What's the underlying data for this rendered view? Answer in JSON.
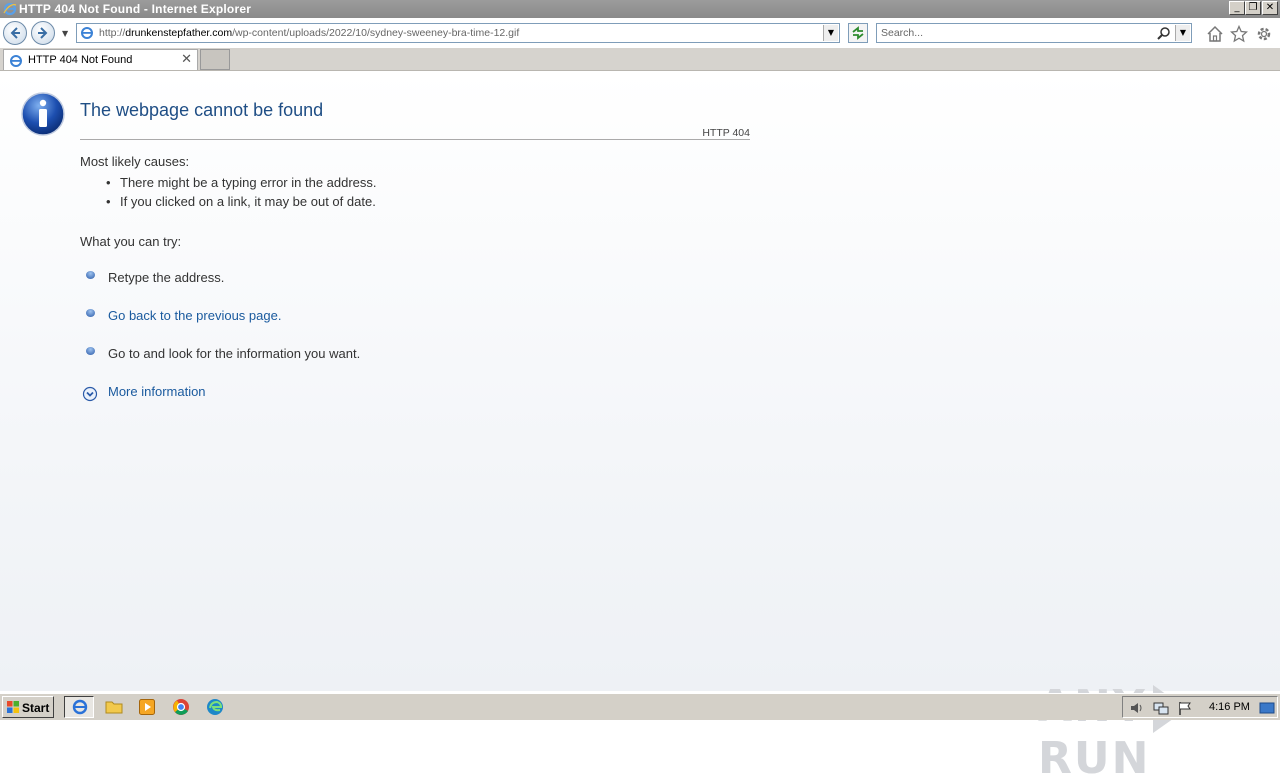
{
  "window": {
    "title": "HTTP 404 Not Found - Internet Explorer",
    "minimize": "_",
    "restore": "❐",
    "close": "✕"
  },
  "navbar": {
    "url_prefix": "http://",
    "url_domain": "drunkenstepfather.com",
    "url_path": "/wp-content/uploads/2022/10/sydney-sweeney-bra-time-12.gif",
    "search_placeholder": "Search...",
    "icons": [
      "back-icon",
      "forward-icon",
      "refresh-icon",
      "search-icon",
      "home-icon",
      "favorites-star-icon",
      "gear-icon"
    ]
  },
  "tabs": [
    {
      "label": "HTTP 404 Not Found",
      "close": "✕"
    }
  ],
  "page": {
    "title": "The webpage cannot be found",
    "code": "HTTP 404",
    "causes_label": "Most likely causes:",
    "causes": [
      "There might be a typing error in the address.",
      "If you clicked on a link, it may be out of date."
    ],
    "try_label": "What you can try:",
    "try_items": [
      {
        "text": "Retype the address.",
        "link": false
      },
      {
        "text": "Go back to the previous page.",
        "link": true
      },
      {
        "text": "Go to  and look for the information you want.",
        "link": false
      }
    ],
    "more_info": "More information",
    "bullet": "•"
  },
  "watermark": {
    "left": "ANY",
    "right": "RUN"
  },
  "taskbar": {
    "start_label": "Start",
    "clock": "4:16 PM",
    "pinned": [
      "internet-explorer-icon",
      "folder-icon",
      "media-player-icon",
      "chrome-icon",
      "edge-icon"
    ]
  },
  "colors": {
    "title_blue": "#1f4e85",
    "link_blue": "#1a5a9e",
    "taskbar_gray": "#d4d0c8"
  }
}
